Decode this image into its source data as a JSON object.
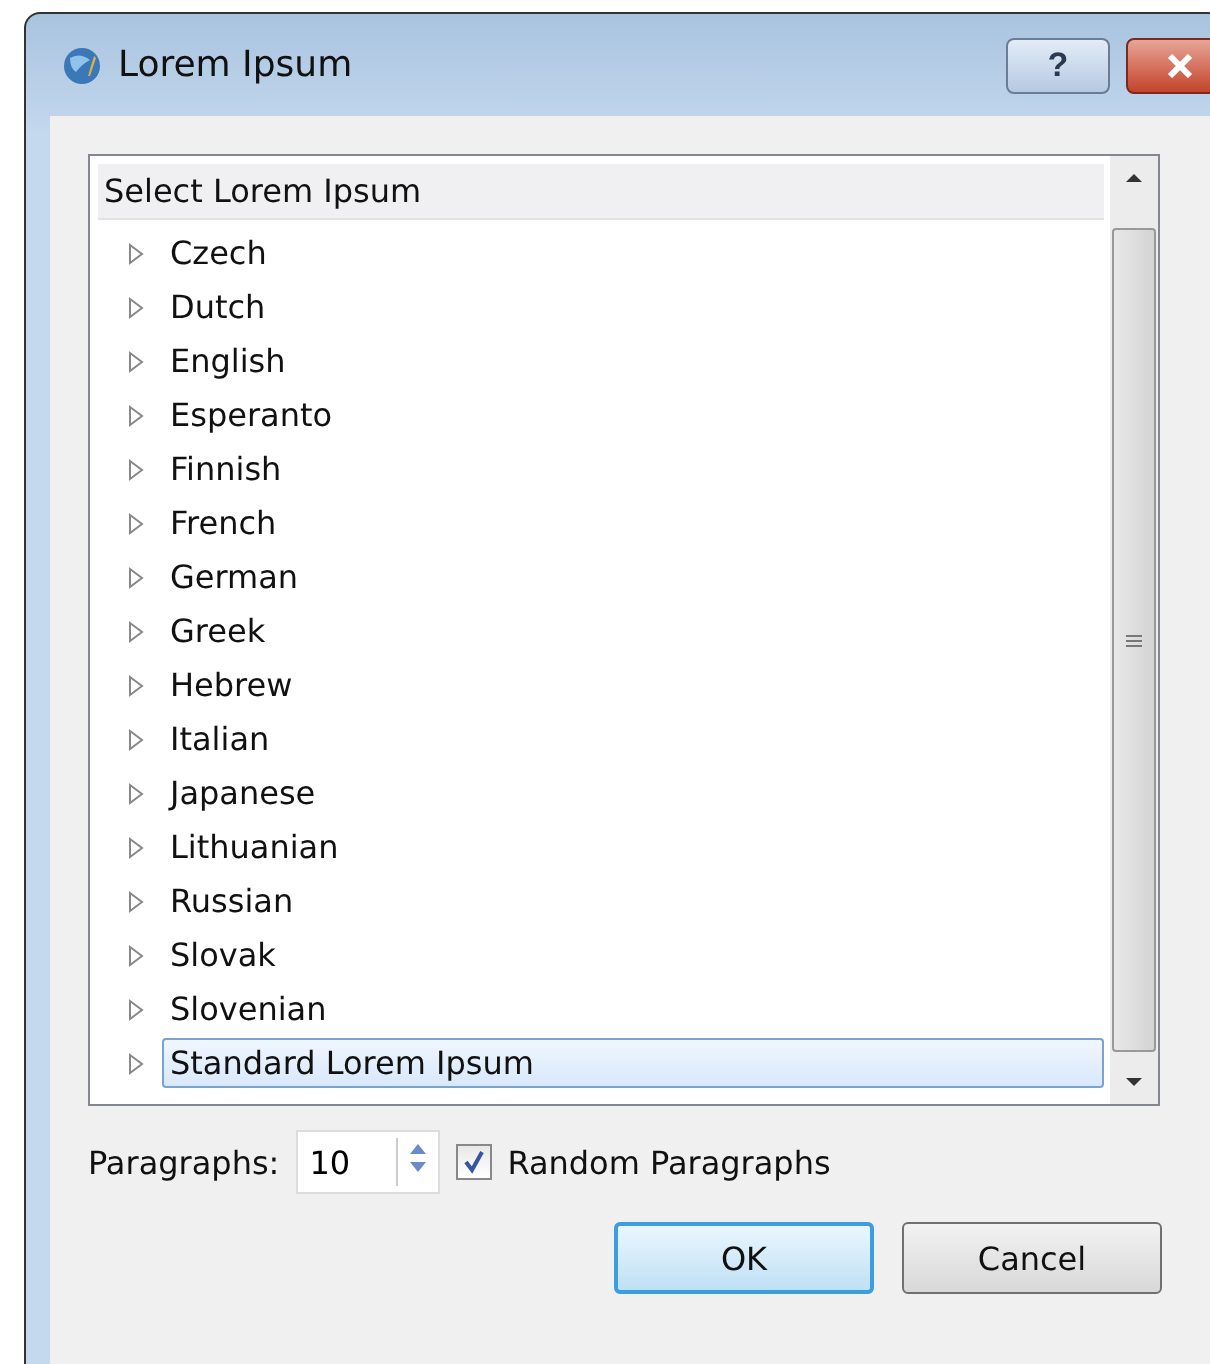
{
  "window": {
    "title": "Lorem Ipsum",
    "help_button": "?"
  },
  "list": {
    "header": "Select Lorem Ipsum",
    "items": [
      {
        "label": "Czech",
        "expanded": false,
        "selected": false
      },
      {
        "label": "Dutch",
        "expanded": false,
        "selected": false
      },
      {
        "label": "English",
        "expanded": false,
        "selected": false
      },
      {
        "label": "Esperanto",
        "expanded": false,
        "selected": false
      },
      {
        "label": "Finnish",
        "expanded": false,
        "selected": false
      },
      {
        "label": "French",
        "expanded": false,
        "selected": false
      },
      {
        "label": "German",
        "expanded": false,
        "selected": false
      },
      {
        "label": "Greek",
        "expanded": false,
        "selected": false
      },
      {
        "label": "Hebrew",
        "expanded": false,
        "selected": false
      },
      {
        "label": "Italian",
        "expanded": false,
        "selected": false
      },
      {
        "label": "Japanese",
        "expanded": false,
        "selected": false
      },
      {
        "label": "Lithuanian",
        "expanded": false,
        "selected": false
      },
      {
        "label": "Russian",
        "expanded": false,
        "selected": false
      },
      {
        "label": "Slovak",
        "expanded": false,
        "selected": false
      },
      {
        "label": "Slovenian",
        "expanded": false,
        "selected": false
      },
      {
        "label": "Standard Lorem Ipsum",
        "expanded": false,
        "selected": true
      }
    ]
  },
  "paragraphs": {
    "label": "Paragraphs:",
    "value": "10"
  },
  "random": {
    "label": "Random Paragraphs",
    "checked": true
  },
  "buttons": [
    {
      "label": "OK",
      "default": true
    },
    {
      "label": "Cancel",
      "default": false
    }
  ]
}
